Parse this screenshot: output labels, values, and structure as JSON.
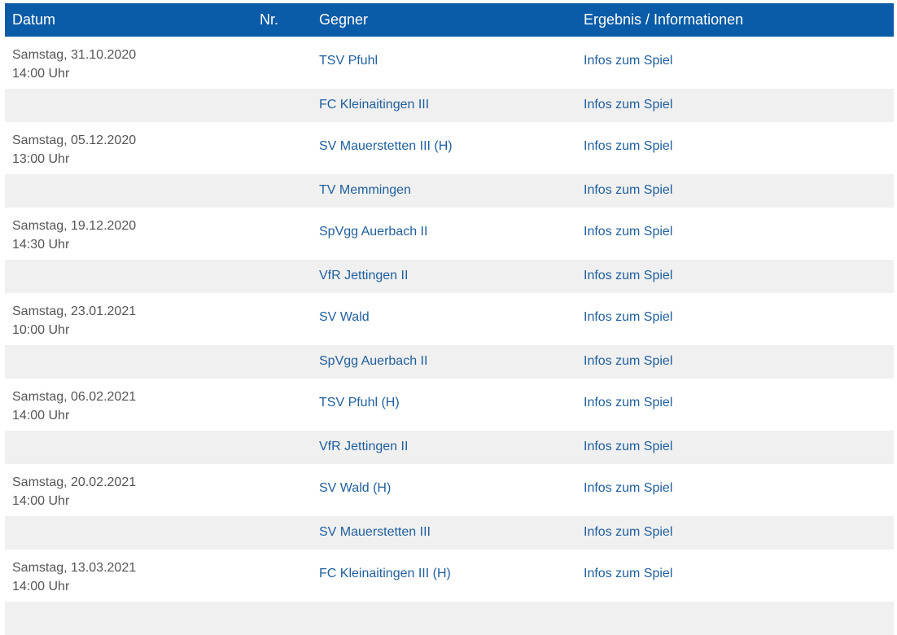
{
  "header": {
    "datum": "Datum",
    "nr": "Nr.",
    "gegner": "Gegner",
    "ergebnis": "Ergebnis / Informationen"
  },
  "rows": [
    {
      "date": "Samstag, 31.10.2020",
      "time": "14:00 Uhr",
      "nr": "",
      "opponent": "TSV Pfuhl",
      "info": "Infos zum Spiel"
    },
    {
      "date": "",
      "time": "",
      "nr": "",
      "opponent": "FC Kleinaitingen III",
      "info": "Infos zum Spiel"
    },
    {
      "date": "Samstag, 05.12.2020",
      "time": "13:00 Uhr",
      "nr": "",
      "opponent": "SV Mauerstetten III (H)",
      "info": "Infos zum Spiel"
    },
    {
      "date": "",
      "time": "",
      "nr": "",
      "opponent": "TV Memmingen",
      "info": "Infos zum Spiel"
    },
    {
      "date": "Samstag, 19.12.2020",
      "time": "14:30 Uhr",
      "nr": "",
      "opponent": "SpVgg Auerbach II",
      "info": "Infos zum Spiel"
    },
    {
      "date": "",
      "time": "",
      "nr": "",
      "opponent": "VfR Jettingen II",
      "info": "Infos zum Spiel"
    },
    {
      "date": "Samstag, 23.01.2021",
      "time": "10:00 Uhr",
      "nr": "",
      "opponent": "SV Wald",
      "info": "Infos zum Spiel"
    },
    {
      "date": "",
      "time": "",
      "nr": "",
      "opponent": "SpVgg Auerbach II",
      "info": "Infos zum Spiel"
    },
    {
      "date": "Samstag, 06.02.2021",
      "time": "14:00 Uhr",
      "nr": "",
      "opponent": "TSV Pfuhl (H)",
      "info": "Infos zum Spiel"
    },
    {
      "date": "",
      "time": "",
      "nr": "",
      "opponent": "VfR Jettingen II",
      "info": "Infos zum Spiel"
    },
    {
      "date": "Samstag, 20.02.2021",
      "time": "14:00 Uhr",
      "nr": "",
      "opponent": "SV Wald (H)",
      "info": "Infos zum Spiel"
    },
    {
      "date": "",
      "time": "",
      "nr": "",
      "opponent": "SV Mauerstetten III",
      "info": "Infos zum Spiel"
    },
    {
      "date": "Samstag, 13.03.2021",
      "time": "14:00 Uhr",
      "nr": "",
      "opponent": "FC Kleinaitingen III (H)",
      "info": "Infos zum Spiel"
    },
    {
      "date": "",
      "time": "",
      "nr": "",
      "opponent": "",
      "info": ""
    }
  ]
}
